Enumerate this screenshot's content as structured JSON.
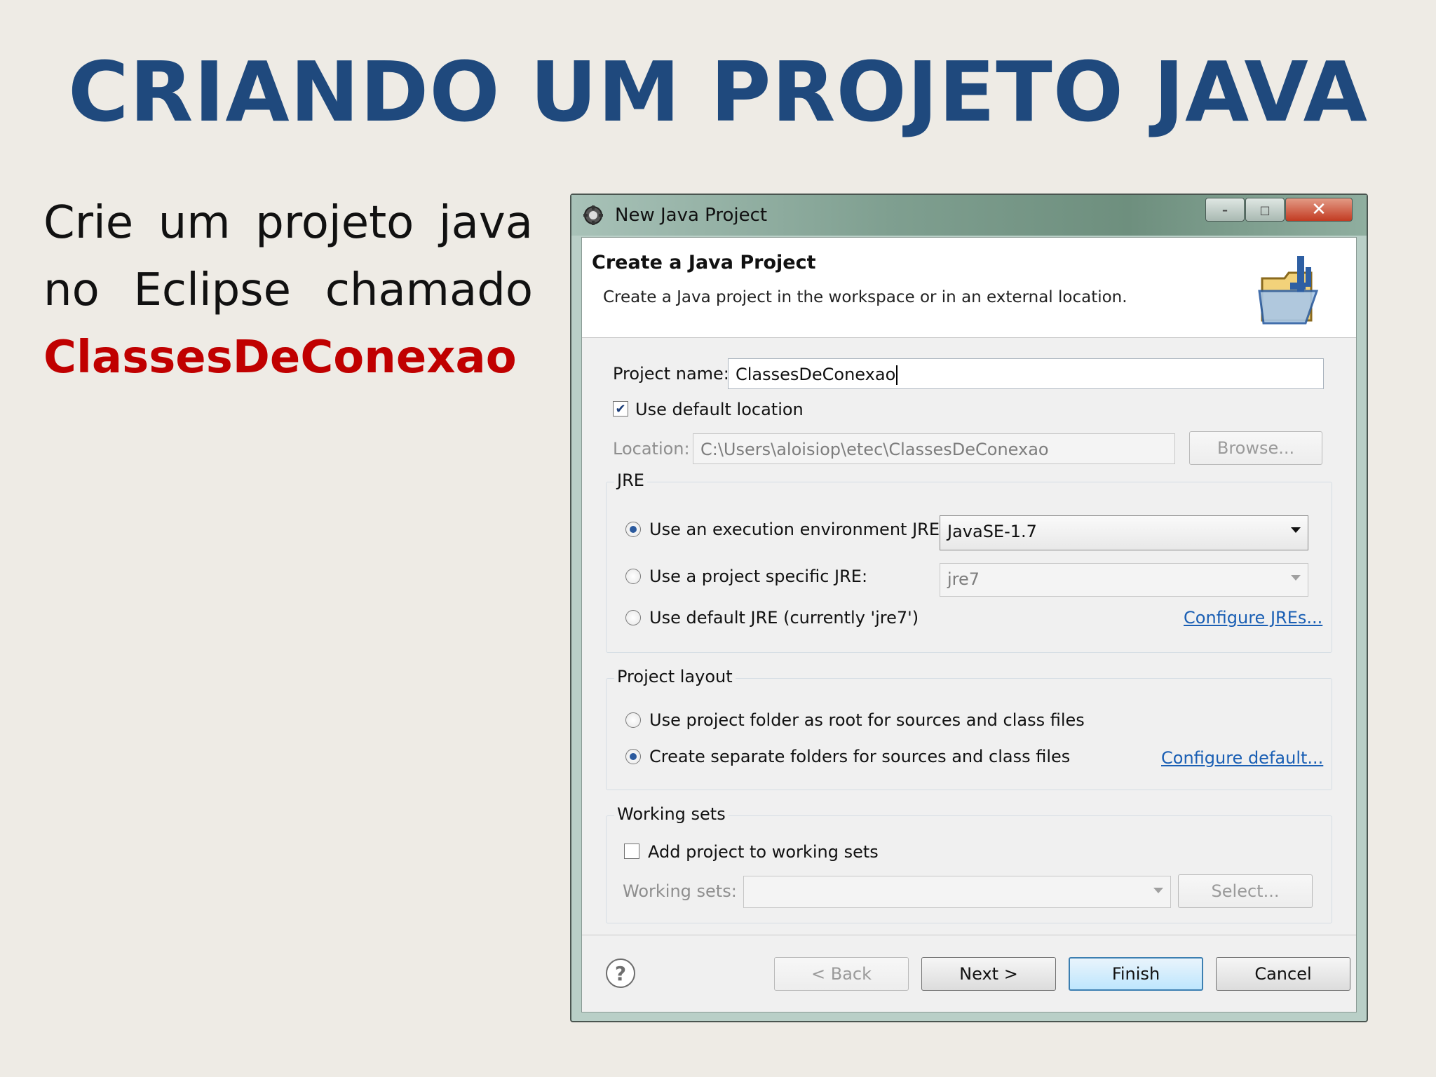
{
  "slide": {
    "title": "CRIANDO UM PROJETO JAVA",
    "instruction_words": [
      [
        "Crie",
        "um",
        "projeto",
        "java"
      ],
      [
        "no",
        "Eclipse",
        "chamado"
      ]
    ],
    "project_highlight": "ClassesDeConexao",
    "colors": {
      "title": "#1f497d",
      "highlight": "#c00000"
    }
  },
  "window": {
    "title": "New Java Project",
    "icon": "eclipse-gear-icon",
    "controls": {
      "minimize": "–",
      "maximize": "□",
      "close": "✕"
    }
  },
  "header": {
    "title": "Create a Java Project",
    "description": "Create a Java project in the workspace or in an external location.",
    "icon": "java-folder-icon"
  },
  "form": {
    "project_name_label": "Project name:",
    "project_name_value": "ClassesDeConexao",
    "use_default_location_label": "Use default location",
    "use_default_location_checked": true,
    "location_label": "Location:",
    "location_value": "C:\\Users\\aloisiop\\etec\\ClassesDeConexao",
    "browse_label": "Browse..."
  },
  "jre": {
    "group_title": "JRE",
    "option_env_label": "Use an execution environment JRE:",
    "option_env_value": "JavaSE-1.7",
    "option_specific_label": "Use a project specific JRE:",
    "option_specific_value": "jre7",
    "option_default_label": "Use default JRE (currently 'jre7')",
    "configure_link": "Configure JREs...",
    "selected": "execution-environment"
  },
  "layout": {
    "group_title": "Project layout",
    "option_root_label": "Use project folder as root for sources and class files",
    "option_separate_label": "Create separate folders for sources and class files",
    "configure_link": "Configure default...",
    "selected": "separate-folders"
  },
  "working_sets": {
    "group_title": "Working sets",
    "add_label": "Add project to working sets",
    "add_checked": false,
    "sets_label": "Working sets:",
    "sets_value": "",
    "select_label": "Select..."
  },
  "footer": {
    "help_symbol": "?",
    "back_label": "< Back",
    "next_label": "Next >",
    "finish_label": "Finish",
    "cancel_label": "Cancel"
  }
}
